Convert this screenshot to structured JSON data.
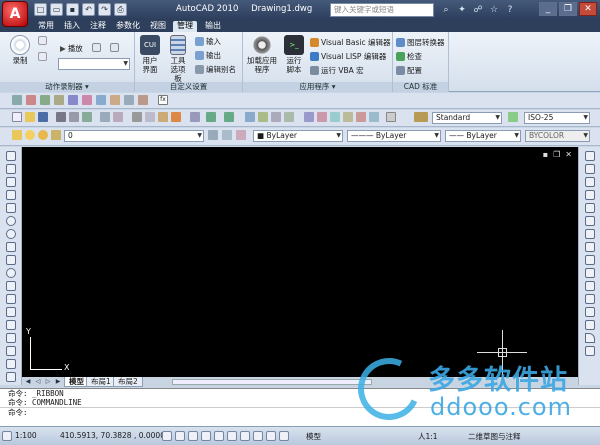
{
  "titlebar": {
    "app_title": "AutoCAD 2010",
    "doc_title": "Drawing1.dwg",
    "search_placeholder": "键入关键字或短语"
  },
  "tabs": [
    "常用",
    "插入",
    "注释",
    "参数化",
    "视图",
    "管理",
    "输出"
  ],
  "active_tab": "管理",
  "ribbon": {
    "action_recorder": {
      "title": "动作录制器",
      "record": "录制",
      "play": "播放"
    },
    "custom": {
      "title": "自定义设置",
      "user_interface": "用户界面",
      "tool_palettes": "工具选项板",
      "import": "输入",
      "export": "输出",
      "edit_aliases": "编辑别名"
    },
    "applications": {
      "title": "应用程序",
      "load_app": "加载应用程序",
      "run_script": "运行脚本",
      "vba_editor": "Visual Basic 编辑器",
      "vlisp_editor": "Visual LISP 编辑器",
      "run_vba": "运行 VBA 宏"
    },
    "cad_standards": {
      "title": "CAD 标准",
      "layer_translator": "图层转换器",
      "check": "检查",
      "configure": "配置"
    }
  },
  "toolbar": {
    "text_style": "Standard",
    "dim_style": "ISO-25",
    "layer": "0",
    "color": "ByLayer",
    "linetype": "ByLayer",
    "lineweight": "ByLayer",
    "plotstyle": "BYCOLOR"
  },
  "canvas": {
    "axis_x": "X",
    "axis_y": "Y"
  },
  "layout_tabs": [
    "模型",
    "布局1",
    "布局2"
  ],
  "command": {
    "lines": [
      "命令: _RIBBON",
      "命令: COMMANDLINE",
      "命令:"
    ]
  },
  "status": {
    "scale": "1:100",
    "coords": "410.5913, 70.3828 , 0.0000",
    "model": "模型",
    "annotation_scale": "人1:1",
    "workspace": "二维草图与注释"
  },
  "watermark": {
    "brand": "多多软件站",
    "url": "ddooo.com"
  }
}
